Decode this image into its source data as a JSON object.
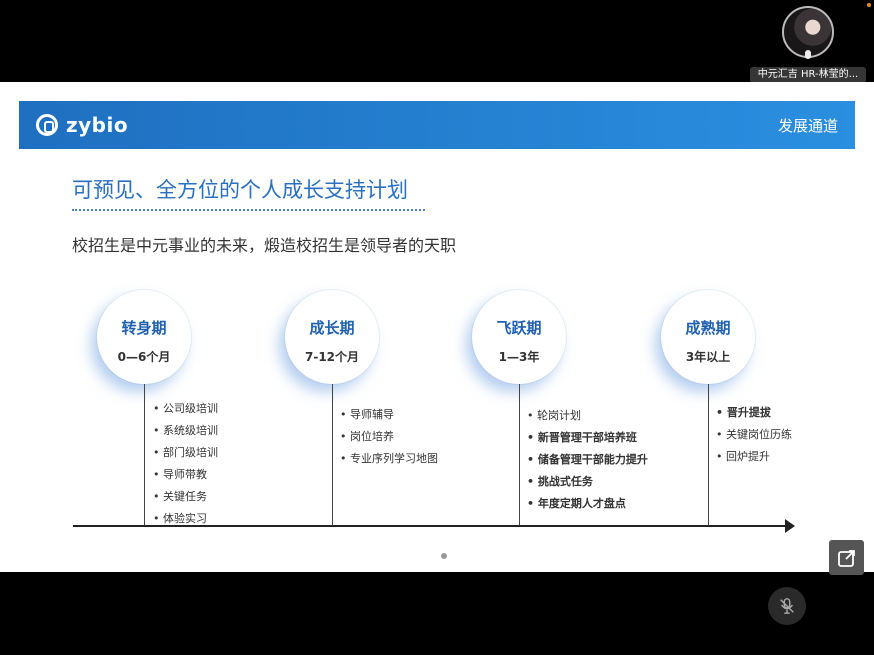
{
  "participant": {
    "name": "中元汇吉 HR-林莹的..."
  },
  "slide": {
    "brand": "zybio",
    "section": "发展通道",
    "title": "可预见、全方位的个人成长支持计划",
    "subtitle": "校招生是中元事业的未来，煅造校招生是领导者的天职",
    "stages": [
      {
        "title": "转身期",
        "period": "0—6个月",
        "items": [
          {
            "text": "公司级培训",
            "bold": true
          },
          {
            "text": "系统级培训",
            "bold": false
          },
          {
            "text": "部门级培训",
            "bold": false
          },
          {
            "text": "导师带教",
            "bold": false
          },
          {
            "text": "关键任务",
            "bold": false
          },
          {
            "text": "体验实习",
            "bold": false
          }
        ]
      },
      {
        "title": "成长期",
        "period": "7-12个月",
        "items": [
          {
            "text": "导师辅导",
            "bold": true
          },
          {
            "text": "岗位培养",
            "bold": false
          },
          {
            "text": "专业序列学习地图",
            "bold": false
          }
        ]
      },
      {
        "title": "飞跃期",
        "period": "1—3年",
        "items": [
          {
            "text": "轮岗计划",
            "bold": false
          },
          {
            "text": "新晋管理干部培养班",
            "bold": true
          },
          {
            "text": "储备管理干部能力提升",
            "bold": true
          },
          {
            "text": "挑战式任务",
            "bold": true
          },
          {
            "text": "年度定期人才盘点",
            "bold": true
          }
        ]
      },
      {
        "title": "成熟期",
        "period": "3年以上",
        "items": [
          {
            "text": "晋升提拔",
            "bold": true
          },
          {
            "text": "关键岗位历练",
            "bold": false
          },
          {
            "text": "回炉提升",
            "bold": false
          }
        ]
      }
    ]
  },
  "controls": {
    "expand_icon": "expand-icon",
    "mic_icon": "mic-muted-icon"
  }
}
